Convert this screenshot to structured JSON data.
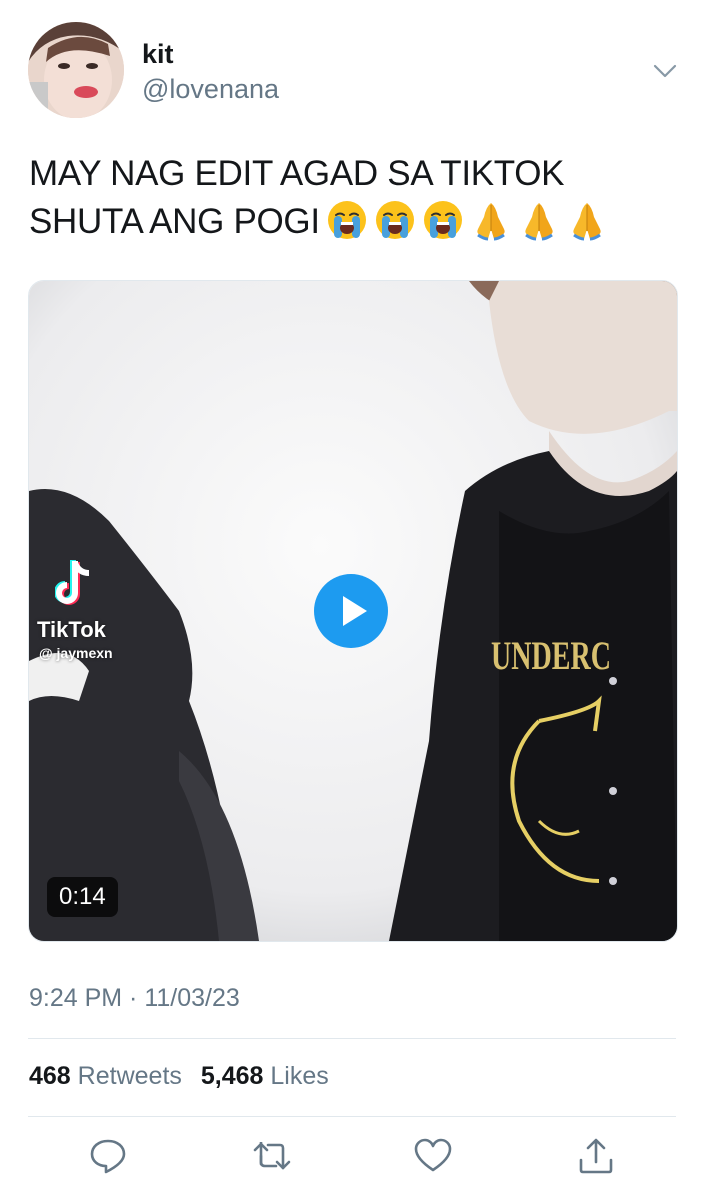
{
  "author": {
    "display_name": "kit",
    "handle": "@lovenana"
  },
  "tweet": {
    "text_line1": "MAY NAG EDIT AGAD SA TIKTOK",
    "text_line2": "SHUTA ANG POGI",
    "emojis": [
      "loudly-crying-face",
      "loudly-crying-face",
      "loudly-crying-face",
      "folded-hands",
      "folded-hands",
      "folded-hands"
    ]
  },
  "media": {
    "type": "video",
    "duration": "0:14",
    "watermark_app": "TikTok",
    "watermark_user": "@ jaymexn",
    "shirt_text": "UNDERC"
  },
  "meta": {
    "time": "9:24 PM · 11/03/23"
  },
  "stats": {
    "retweets_count": "468",
    "retweets_label": "Retweets",
    "likes_count": "5,468",
    "likes_label": "Likes"
  },
  "actions": [
    "reply-icon",
    "retweet-icon",
    "like-icon",
    "share-icon"
  ],
  "colors": {
    "accent": "#1d9bf0",
    "text_primary": "#14171a",
    "text_secondary": "#657786",
    "divider": "#e1e8ed"
  }
}
